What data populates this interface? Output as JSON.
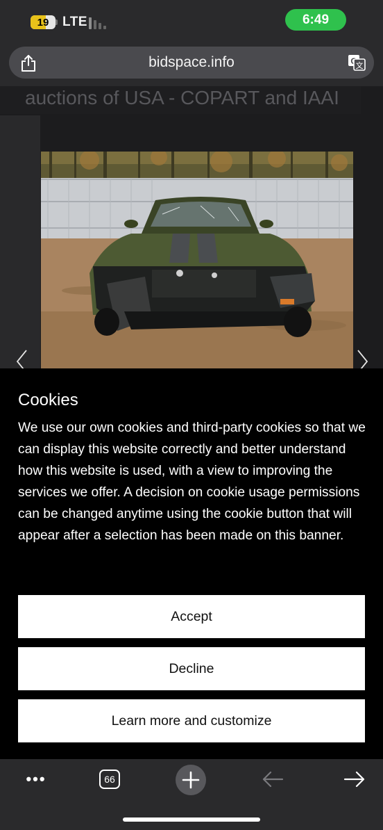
{
  "status_bar": {
    "battery_level": "19",
    "network": "LTE",
    "time": "6:49",
    "colors": {
      "battery_fill": "#e8c21a",
      "time_pill": "#2fc14d"
    }
  },
  "browser": {
    "url": "bidspace.info",
    "share_icon": "share-icon",
    "translate_icon": "translate-icon"
  },
  "page": {
    "heading": "auctions of USA - COPART and IAAI",
    "prev_icon": "chevron-left-icon",
    "next_icon": "chevron-right-icon"
  },
  "cookie_banner": {
    "title": "Cookies",
    "text": "We use our own cookies and third-party cookies so that we can display this website correctly and better understand how this website is used, with a view to improving the services we offer. A decision on cookie usage permissions can be changed anytime using the cookie button that will appear after a selection has been made on this banner.",
    "buttons": {
      "accept": "Accept",
      "decline": "Decline",
      "learn_more": "Learn more and customize"
    }
  },
  "toolbar": {
    "more_label": "•••",
    "tab_count": "66",
    "new_tab_icon": "plus-icon",
    "back_icon": "arrow-left-icon",
    "forward_icon": "arrow-right-icon"
  }
}
